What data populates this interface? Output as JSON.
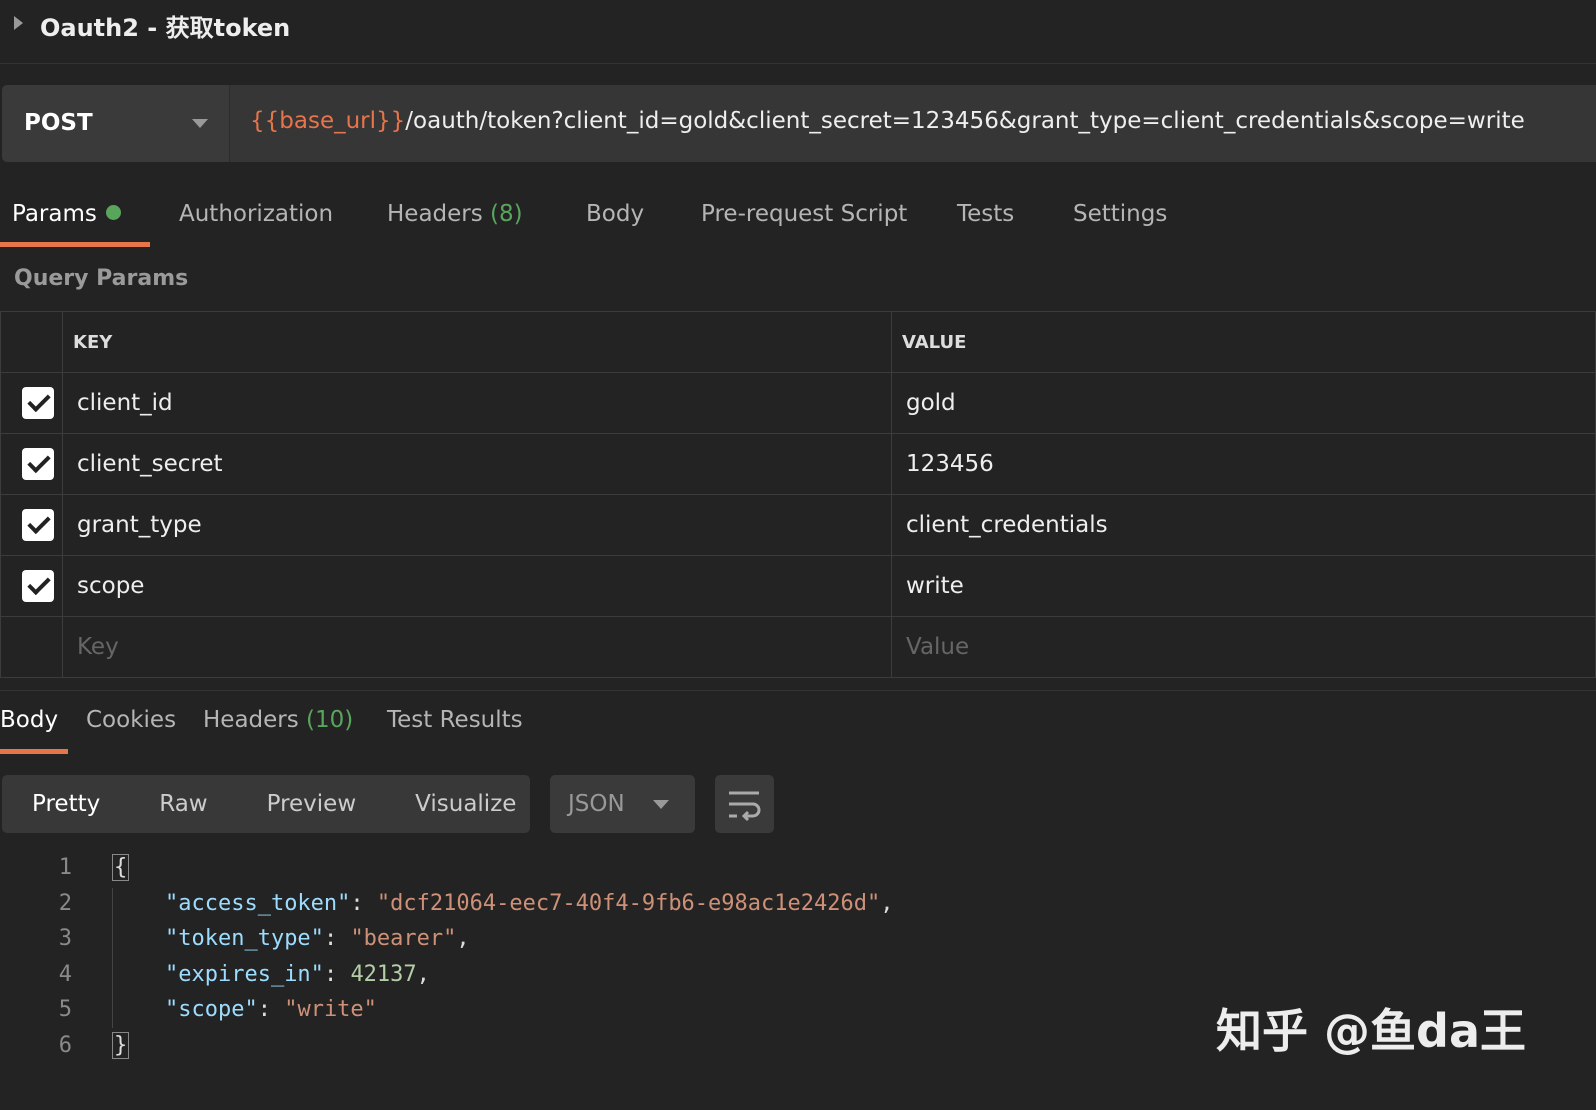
{
  "request": {
    "name": "Oauth2 - 获取token",
    "method": "POST",
    "url_var": "{{base_url}}",
    "url_rest": "/oauth/token?client_id=gold&client_secret=123456&grant_type=client_credentials&scope=write"
  },
  "req_tabs": {
    "params": "Params",
    "authorization": "Authorization",
    "headers": "Headers",
    "headers_count": "(8)",
    "body": "Body",
    "prerequest": "Pre-request Script",
    "tests": "Tests",
    "settings": "Settings"
  },
  "query_params": {
    "title": "Query Params",
    "key_header": "KEY",
    "value_header": "VALUE",
    "rows": [
      {
        "key": "client_id",
        "value": "gold",
        "checked": true
      },
      {
        "key": "client_secret",
        "value": "123456",
        "checked": true
      },
      {
        "key": "grant_type",
        "value": "client_credentials",
        "checked": true
      },
      {
        "key": "scope",
        "value": "write",
        "checked": true
      }
    ],
    "key_placeholder": "Key",
    "value_placeholder": "Value"
  },
  "resp_tabs": {
    "body": "Body",
    "cookies": "Cookies",
    "headers": "Headers",
    "headers_count": "(10)",
    "test_results": "Test Results"
  },
  "view": {
    "pretty": "Pretty",
    "raw": "Raw",
    "preview": "Preview",
    "visualize": "Visualize",
    "format": "JSON"
  },
  "response": {
    "lines": [
      "1",
      "2",
      "3",
      "4",
      "5",
      "6"
    ],
    "open": "{",
    "close": "}",
    "k1": "\"access_token\"",
    "v1": "\"dcf21064-eec7-40f4-9fb6-e98ac1e2426d\"",
    "k2": "\"token_type\"",
    "v2": "\"bearer\"",
    "k3": "\"expires_in\"",
    "v3": "42137",
    "k4": "\"scope\"",
    "v4": "\"write\""
  },
  "watermark": "知乎 @鱼da王",
  "colors": {
    "accent": "#e8744a",
    "green": "#58a55c",
    "bg": "#232323"
  }
}
